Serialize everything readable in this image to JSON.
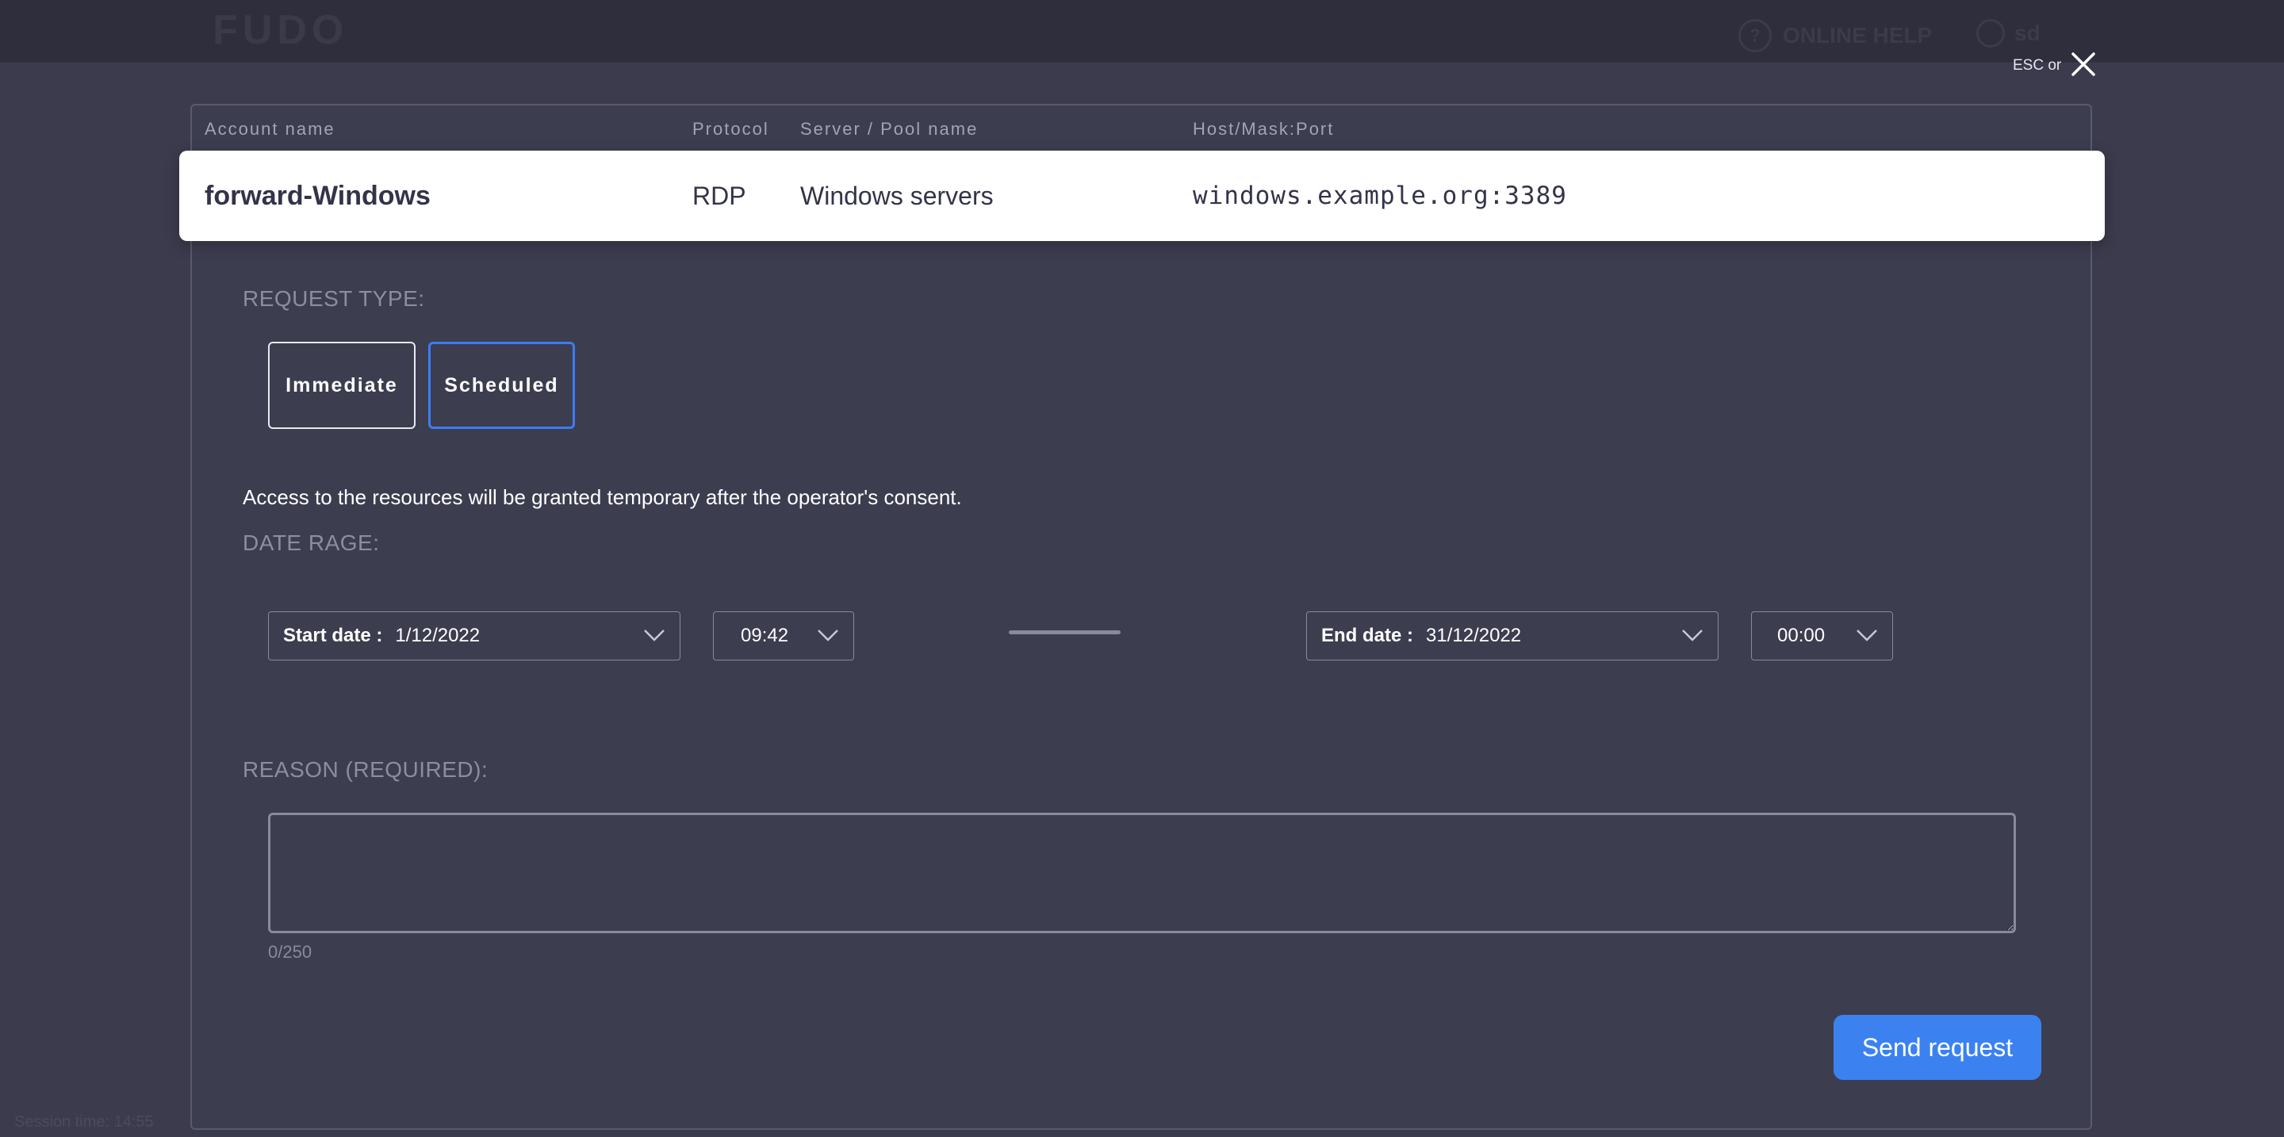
{
  "header": {
    "logo": "FUDO",
    "online_help": "ONLINE HELP",
    "user": "sd"
  },
  "modal": {
    "esc_hint": "ESC or",
    "columns": {
      "account": "Account name",
      "protocol": "Protocol",
      "server": "Server / Pool name",
      "host": "Host/Mask:Port"
    },
    "account": {
      "name": "forward-Windows",
      "protocol": "RDP",
      "server": "Windows servers",
      "host": "windows.example.org:3389"
    },
    "request_type": {
      "title": "REQUEST TYPE:",
      "options": [
        "Immediate",
        "Scheduled"
      ],
      "selected": "Scheduled"
    },
    "consent_text": "Access to the resources will be granted temporary after the operator's consent.",
    "date_range": {
      "title": "DATE RAGE:",
      "start_label": "Start date :",
      "start_date": "1/12/2022",
      "start_time": "09:42",
      "end_label": "End date :",
      "end_date": "31/12/2022",
      "end_time": "00:00"
    },
    "reason": {
      "title": "REASON (REQUIRED):",
      "value": "",
      "counter": "0/250"
    },
    "send_button": "Send request"
  },
  "footer": {
    "session_time": "Session time: 14:55"
  },
  "colors": {
    "accent": "#3b82f0",
    "background": "#3b3b4d",
    "card": "#ffffff"
  }
}
